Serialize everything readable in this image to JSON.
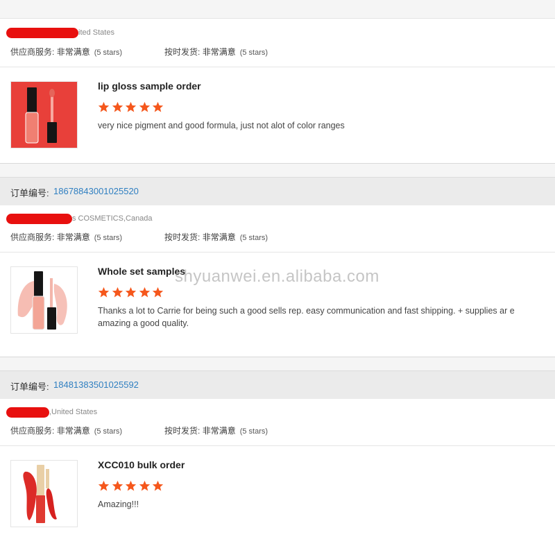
{
  "colors": {
    "accent_link": "#2f7fc1",
    "star": "#f5571c",
    "redaction": "#e8100f"
  },
  "watermark": "shyuanwei.en.alibaba.com",
  "reviews": [
    {
      "buyer_location": "ited States",
      "ratings": {
        "supplier_label": "供应商服务:",
        "supplier_value": "非常满意",
        "supplier_stars": "(5 stars)",
        "ontime_label": "按时发货:",
        "ontime_value": "非常满意",
        "ontime_stars": "(5 stars)"
      },
      "product_title": "lip gloss sample order",
      "stars": 5,
      "comment": "very nice pigment and good formula, just not alot of color ranges"
    },
    {
      "order_label": "订单编号:",
      "order_number": "18678843001025520",
      "buyer_location": "s COSMETICS,Canada",
      "ratings": {
        "supplier_label": "供应商服务:",
        "supplier_value": "非常满意",
        "supplier_stars": "(5 stars)",
        "ontime_label": "按时发货:",
        "ontime_value": "非常满意",
        "ontime_stars": "(5 stars)"
      },
      "product_title": "Whole set samples",
      "stars": 5,
      "comment": "Thanks a lot to Carrie for being such a good sells rep. easy communication and fast shipping. + supplies ar e amazing a good quality."
    },
    {
      "order_label": "订单编号:",
      "order_number": "18481383501025592",
      "buyer_location": ",United States",
      "ratings": {
        "supplier_label": "供应商服务:",
        "supplier_value": "非常满意",
        "supplier_stars": "(5 stars)",
        "ontime_label": "按时发货:",
        "ontime_value": "非常满意",
        "ontime_stars": "(5 stars)"
      },
      "product_title": "XCC010 bulk order",
      "stars": 5,
      "comment": "Amazing!!!"
    }
  ]
}
